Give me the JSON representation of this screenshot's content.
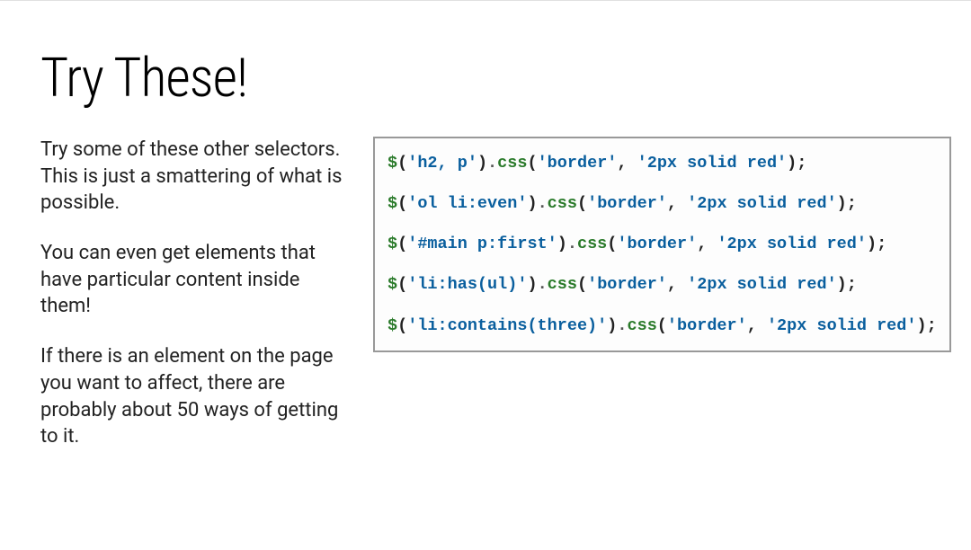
{
  "title": "Try These!",
  "paragraphs": [
    "Try some of these other selectors. This is just a smattering of what is possible.",
    "You can even get elements that have particular content inside them!",
    "If there is an element on the page you want to affect, there are probably about 50 ways of getting to it."
  ],
  "code_lines": [
    "$('h2, p').css('border', '2px solid red');",
    "$('ol li:even').css('border', '2px solid red');",
    "$('#main p:first').css('border', '2px solid red');",
    "$('li:has(ul)').css('border', '2px solid red');",
    "$('li:contains(three)').css('border', '2px solid red');"
  ]
}
